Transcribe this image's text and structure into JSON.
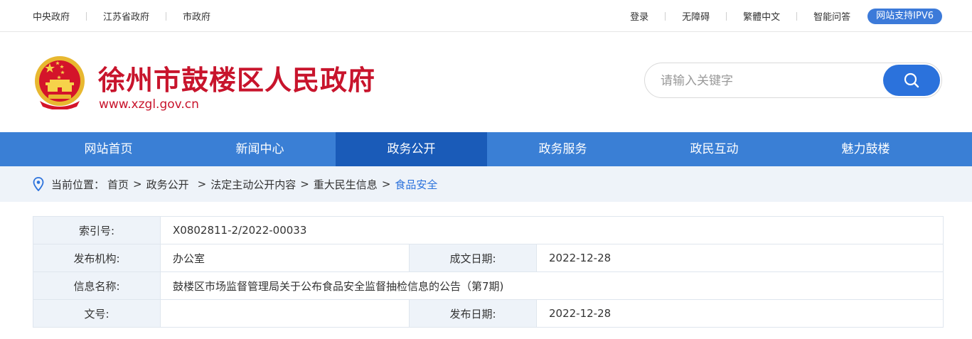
{
  "topbar": {
    "left_links": [
      "中央政府",
      "江苏省政府",
      "市政府"
    ],
    "right_links": [
      "登录",
      "无障碍",
      "繁體中文",
      "智能问答"
    ],
    "ipv6_badge": "网站支持IPV6"
  },
  "header": {
    "title": "徐州市鼓楼区人民政府",
    "url": "www.xzgl.gov.cn",
    "search_placeholder": "请输入关键字",
    "search_value": ""
  },
  "nav": {
    "items": [
      "网站首页",
      "新闻中心",
      "政务公开",
      "政务服务",
      "政民互动",
      "魅力鼓楼"
    ],
    "active": "政务公开"
  },
  "breadcrumb": {
    "prefix": "当前位置：",
    "items": [
      "首页",
      "政务公开",
      "法定主动公开内容",
      "重大民生信息",
      "食品安全"
    ],
    "separator": ">"
  },
  "info": {
    "index_label": "索引号:",
    "index_value": "X0802811-2/2022-00033",
    "org_label": "发布机构:",
    "org_value": "办公室",
    "written_date_label": "成文日期:",
    "written_date_value": "2022-12-28",
    "name_label": "信息名称:",
    "name_value": "鼓楼区市场监督管理局关于公布食品安全监督抽检信息的公告（第7期)",
    "docno_label": "文号:",
    "docno_value": "",
    "publish_date_label": "发布日期:",
    "publish_date_value": "2022-12-28"
  },
  "colors": {
    "brand_red": "#c8142c",
    "nav_blue": "#3a7fd5",
    "nav_active": "#1a5bb8",
    "link_blue": "#2b72dc",
    "label_bg": "#eef3f9"
  },
  "icons": [
    "national-emblem-icon",
    "search-icon",
    "location-pin-icon"
  ]
}
